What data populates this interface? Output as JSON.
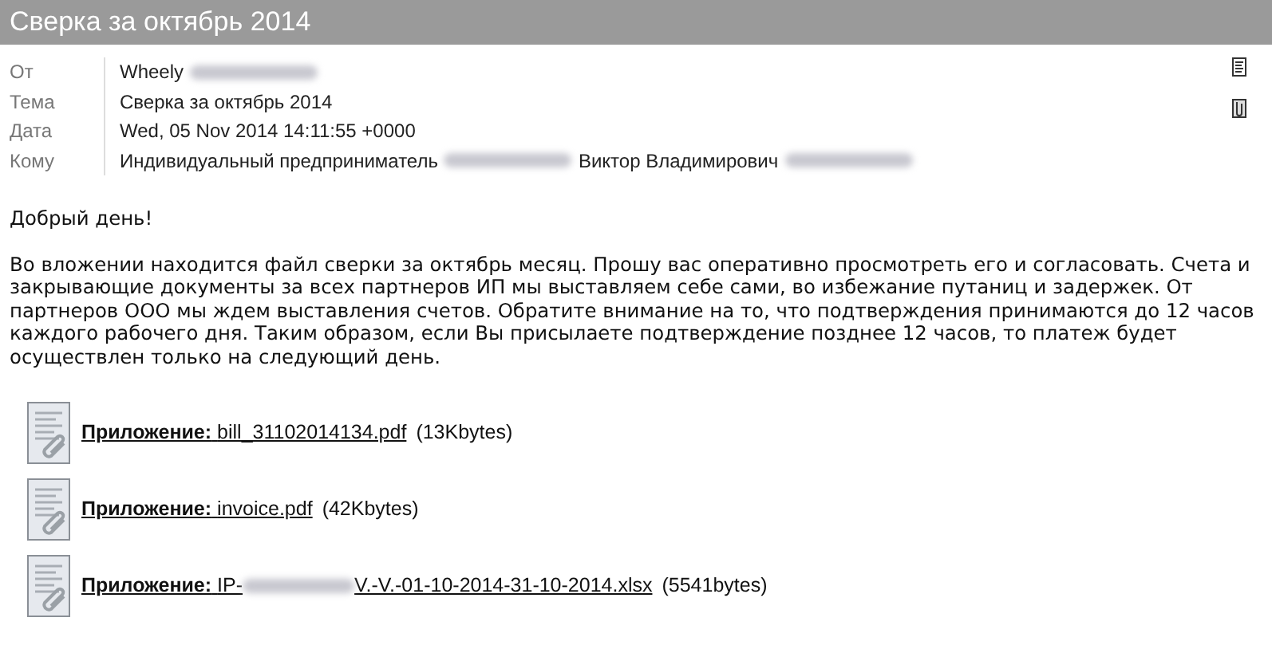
{
  "title": "Сверка за октябрь 2014",
  "header": [
    {
      "label": "От",
      "parts": [
        {
          "kind": "text",
          "text": "Wheely"
        },
        {
          "kind": "redacted"
        }
      ]
    },
    {
      "label": "Тема",
      "parts": [
        {
          "kind": "text",
          "text": "Сверка за октябрь 2014"
        }
      ]
    },
    {
      "label": "Дата",
      "parts": [
        {
          "kind": "text",
          "text": "Wed, 05 Nov 2014 14:11:55 +0000"
        }
      ]
    },
    {
      "label": "Кому",
      "parts": [
        {
          "kind": "text",
          "text": "Индивидуальный предприниматель"
        },
        {
          "kind": "redacted"
        },
        {
          "kind": "text",
          "text": "Виктор Владимирович"
        },
        {
          "kind": "redacted"
        }
      ]
    }
  ],
  "greeting": "Добрый день!",
  "body": "Во вложении находится файл сверки за октябрь месяц. Прошу вас оперативно просмотреть его и согласовать. Счета и закрывающие документы за всех партнеров ИП мы выставляем себе сами, во избежание путаниц и задержек. От партнеров ООО мы ждем выставления счетов. Обратите внимание на то, что подтверждения принимаются до 12 часов каждого рабочего дня. Таким образом, если Вы присылаете подтверждение позднее 12 часов, то платеж будет осуществлен только на следующий день.",
  "attachments": [
    {
      "label": "Приложение:",
      "name_parts": [
        {
          "kind": "text",
          "text": "bill_31102014134.pdf"
        }
      ],
      "size": "(13Kbytes)"
    },
    {
      "label": "Приложение:",
      "name_parts": [
        {
          "kind": "text",
          "text": "invoice.pdf"
        }
      ],
      "size": "(42Kbytes)"
    },
    {
      "label": "Приложение:",
      "name_parts": [
        {
          "kind": "text",
          "text": "IP-"
        },
        {
          "kind": "redacted"
        },
        {
          "kind": "text",
          "text": "V.-V.-01-10-2014-31-10-2014.xlsx"
        }
      ],
      "size": "(5541bytes)"
    }
  ]
}
